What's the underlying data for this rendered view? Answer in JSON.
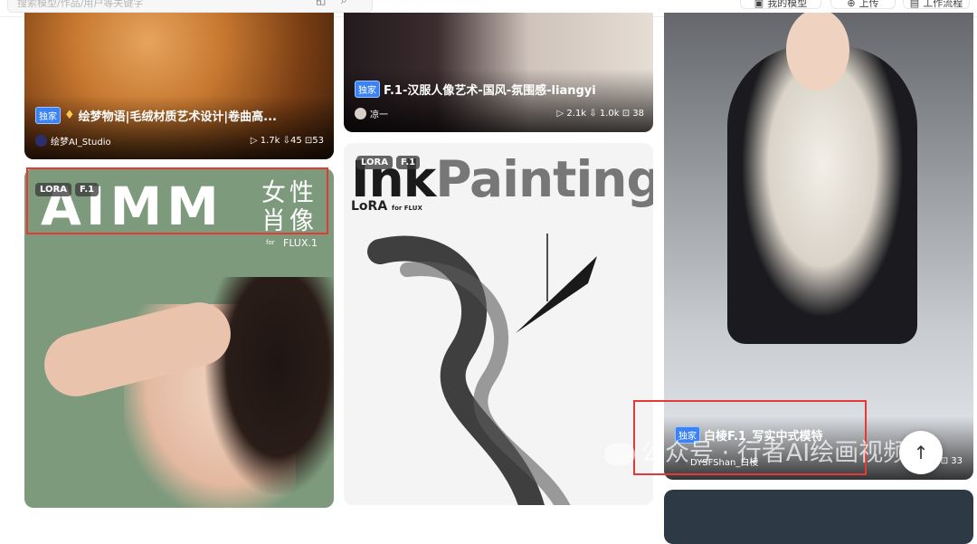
{
  "header": {
    "search_placeholder": "搜索模型/作品/用户等关键字",
    "buttons": [
      {
        "label": "我的模型",
        "icon": "cube-icon"
      },
      {
        "label": "上传",
        "icon": "upload-icon"
      },
      {
        "label": "工作流程",
        "icon": "workflow-icon"
      }
    ]
  },
  "cards": [
    {
      "badge": "独家",
      "title": "绘梦物语|毛绒材质艺术设计|卷曲高...",
      "author": "绘梦AI_Studio",
      "stats": "▷ 1.7k  ⇩45  ⊡53"
    },
    {
      "badge": "独家",
      "title": "F.1-汉服人像艺术-国风-氛围感-liangyi",
      "author": "凉一",
      "stats": "▷ 2.1k  ⇩ 1.0k  ⊡ 38"
    },
    {
      "tags": [
        "LORA",
        "F.1"
      ],
      "art_title": "AIMM",
      "art_zh": "女性肖像",
      "art_for": "for",
      "art_flux": "FLUX.1"
    },
    {
      "tags": [
        "LORA",
        "F.1"
      ],
      "art_title_a": "Ink",
      "art_title_b": "Painting",
      "art_lora": "LoRA",
      "art_lora_for": "for FLUX"
    },
    {
      "badge": "独家",
      "title": "白棱F.1_写实中式模特",
      "author": "DYSFShan_白棱",
      "stats": "▷ 2.3k  ⊡ 33"
    }
  ],
  "watermark": "公众号 · 行者AI绘画视频",
  "colors": {
    "accent": "#3b82f6",
    "highlight": "#e53935"
  }
}
